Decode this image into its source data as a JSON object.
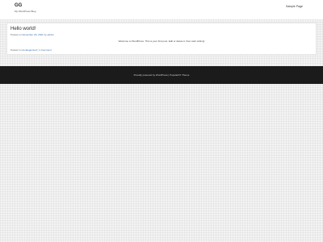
{
  "header": {
    "site_title": "GG",
    "tagline": "My WordPress Blog",
    "nav_link": "Sample Page"
  },
  "post": {
    "title": "Hello world!",
    "meta_posted_on": "Posted on",
    "meta_date": "November 26, 2021",
    "meta_by": "by",
    "meta_author": "admin",
    "body": "Welcome to WordPress. This is your first post. Edit or delete it, then start writing!",
    "footer_posted_in": "Posted in",
    "footer_category": "Uncategorized",
    "footer_separator": "|",
    "footer_comment": "1 Comment"
  },
  "footer": {
    "credit": "Proudly powered by WordPress | PopularFX Theme"
  },
  "colors": {
    "link": "#3a6fb0",
    "footer_bg": "#1b1b1b"
  }
}
